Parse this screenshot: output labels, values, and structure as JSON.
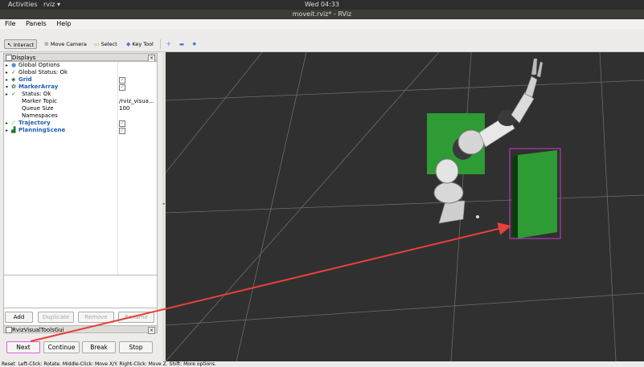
{
  "topbar": {
    "activities": "Activities",
    "app": "rviz ▾",
    "clock": "Wed 04:33"
  },
  "window_title": "moveit.rviz* - RViz",
  "menu": [
    "File",
    "Panels",
    "Help"
  ],
  "toolbar": {
    "items": [
      {
        "icon": "pointer-icon",
        "glyph": "↖",
        "label": "Interact",
        "active": true
      },
      {
        "icon": "camera-icon",
        "glyph": "⊕",
        "label": "Move Camera",
        "active": false
      },
      {
        "icon": "select-icon",
        "glyph": "▭",
        "label": "Select",
        "active": false
      },
      {
        "icon": "key-icon",
        "glyph": "◆",
        "label": "Key Tool",
        "active": false
      }
    ],
    "extra_icons": [
      "move-icon",
      "minus-icon",
      "point-icon"
    ],
    "extra_glyphs": [
      "✛",
      "▬",
      "✹"
    ]
  },
  "displays": {
    "title": "Displays",
    "close": "×",
    "rows": [
      {
        "arrow": "▸",
        "icon": "●",
        "icon_color": "#5a8fd6",
        "label": "Global Options",
        "style": "",
        "value": ""
      },
      {
        "arrow": "▸",
        "icon": "✓",
        "icon_color": "#1a8a2a",
        "label": "Global Status: Ok",
        "style": "",
        "value": ""
      },
      {
        "arrow": "▸",
        "icon": "◈",
        "icon_color": "#333333",
        "label": "Grid",
        "style": "blue",
        "checked": true
      },
      {
        "arrow": "▾",
        "icon": "✿",
        "icon_color": "#2a7a2a",
        "label": "MarkerArray",
        "style": "blue",
        "checked": true
      },
      {
        "arrow": "▸",
        "icon": "✓",
        "icon_color": "#1a8a2a",
        "label": "Status: Ok",
        "style": "indent",
        "value": ""
      },
      {
        "arrow": "",
        "icon": "",
        "icon_color": "#000000",
        "label": "Marker Topic",
        "style": "indent",
        "value": "/rviz_visua..."
      },
      {
        "arrow": "",
        "icon": "",
        "icon_color": "#000000",
        "label": "Queue Size",
        "style": "indent",
        "value": "100"
      },
      {
        "arrow": "",
        "icon": "",
        "icon_color": "#000000",
        "label": "Namespaces",
        "style": "indent",
        "value": ""
      },
      {
        "arrow": "▸",
        "icon": "⟋",
        "icon_color": "#2a8a2a",
        "label": "Trajectory",
        "style": "blue",
        "checked": true
      },
      {
        "arrow": "▸",
        "icon": "▟",
        "icon_color": "#1a7a2a",
        "label": "PlanningScene",
        "style": "blue",
        "checked": true
      }
    ],
    "buttons": [
      "Add",
      "Duplicate",
      "Remove",
      "Rename"
    ]
  },
  "gui_panel": {
    "title": "RvizVisualToolsGui",
    "close": "×",
    "buttons": [
      "Next",
      "Continue",
      "Break",
      "Stop"
    ]
  },
  "statusbar": {
    "reset": "Reset",
    "hint": "Left-Click: Rotate. Middle-Click: Move X/Y. Right-Click: Move Z. Shift: More options."
  },
  "colors": {
    "grid": "#6b6b6b",
    "box_green": "#2e9b34",
    "highlight": "#c83cc8",
    "arrow": "#e8403a",
    "check": "#1a8a2a"
  }
}
